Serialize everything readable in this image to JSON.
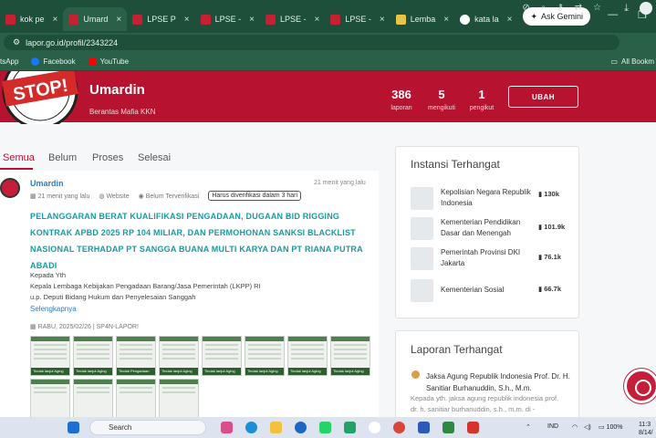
{
  "browser": {
    "tabs": [
      {
        "label": "kok pe"
      },
      {
        "label": "Umard",
        "active": true
      },
      {
        "label": "LPSE P"
      },
      {
        "label": "LPSE -"
      },
      {
        "label": "LPSE -"
      },
      {
        "label": "LPSE -"
      },
      {
        "label": "Lemba"
      },
      {
        "label": "kata la"
      }
    ],
    "tab_close": "×",
    "new_tab": "+",
    "gemini_label": "Ask Gemini",
    "url": "lapor.go.id/profil/2343224",
    "bookmarks": [
      "tsApp",
      "Facebook",
      "YouTube"
    ],
    "all_bookmarks": "All Bookm"
  },
  "profile": {
    "name": "Umardin",
    "tagline": "Berantas Mafia KKN",
    "stats": [
      {
        "value": "386",
        "label": "laporan"
      },
      {
        "value": "5",
        "label": "mengikuti"
      },
      {
        "value": "1",
        "label": "pengikut"
      }
    ],
    "edit_button": "UBAH",
    "logo_text": "STOP!"
  },
  "filters": [
    "Semua",
    "Belum",
    "Proses",
    "Selesai"
  ],
  "report": {
    "author": "Umardin",
    "time": "21 menit yang lalu",
    "meta_time": "21 menit yang lalu",
    "meta_channel": "Website",
    "meta_status": "Belum Terverifikasi",
    "meta_badge": "Harus diverifikasi dalam 3 hari",
    "title": "PELANGGARAN BERAT KUALIFIKASI PENGADAAN, DUGAAN BID RIGGING KONTRAK APBD 2025 RP 104 MILIAR, DAN PERMOHONAN SANKSI BLACKLIST NASIONAL TERHADAP PT SANGGA BUANA MULTI KARYA DAN PT RIANA PUTRA ABADI",
    "body_lines": [
      "Kepada Yth",
      "Kepala Lembaga Kebijakan Pengadaan Barang/Jasa Pemerintah (LKPP) RI",
      "u.p. Deputi Bidang Hukum dan Penyelesaian Sanggah"
    ],
    "read_more": "Selengkapnya",
    "date_line": "RABU, 2025/02/26  |  SP4N-LAPOR!",
    "thumb_captions": [
      "Tindak lanjut Aging",
      "Tindak lanjut Aging",
      "Tindak Pengadaan",
      "Tindak lanjut Aging",
      "Tindak lanjut Aging",
      "Tindak lanjut Aging",
      "Tindak lanjut Aging",
      "Tindak lanjut Aging",
      "",
      "",
      "",
      ""
    ]
  },
  "sidebar": {
    "instansi_title": "Instansi Terhangat",
    "instansi": [
      {
        "name": "Kepolisian Negara Republik Indonesia",
        "count": "130k"
      },
      {
        "name": "Kementerian Pendidikan Dasar dan Menengah",
        "count": "101.9k"
      },
      {
        "name": "Pemerintah Provinsi DKI Jakarta",
        "count": "76.1k"
      },
      {
        "name": "Kementerian Sosial",
        "count": "66.7k"
      }
    ],
    "laporan_title": "Laporan Terhangat",
    "laporan_item_title": "Jaksa Agung Republik Indonesia Prof. Dr. H. Sanitiar Burhanuddin, S.h., M.m.",
    "laporan_item_body": "Kepada yth. jaksa agung republik indonesia prof. dr. h. sanitiar burhanuddin, s.h., m.m. di -"
  },
  "taskbar": {
    "search_placeholder": "Search",
    "lang": "IND",
    "battery": "100%",
    "time": "11:3",
    "date": "8/14/"
  }
}
